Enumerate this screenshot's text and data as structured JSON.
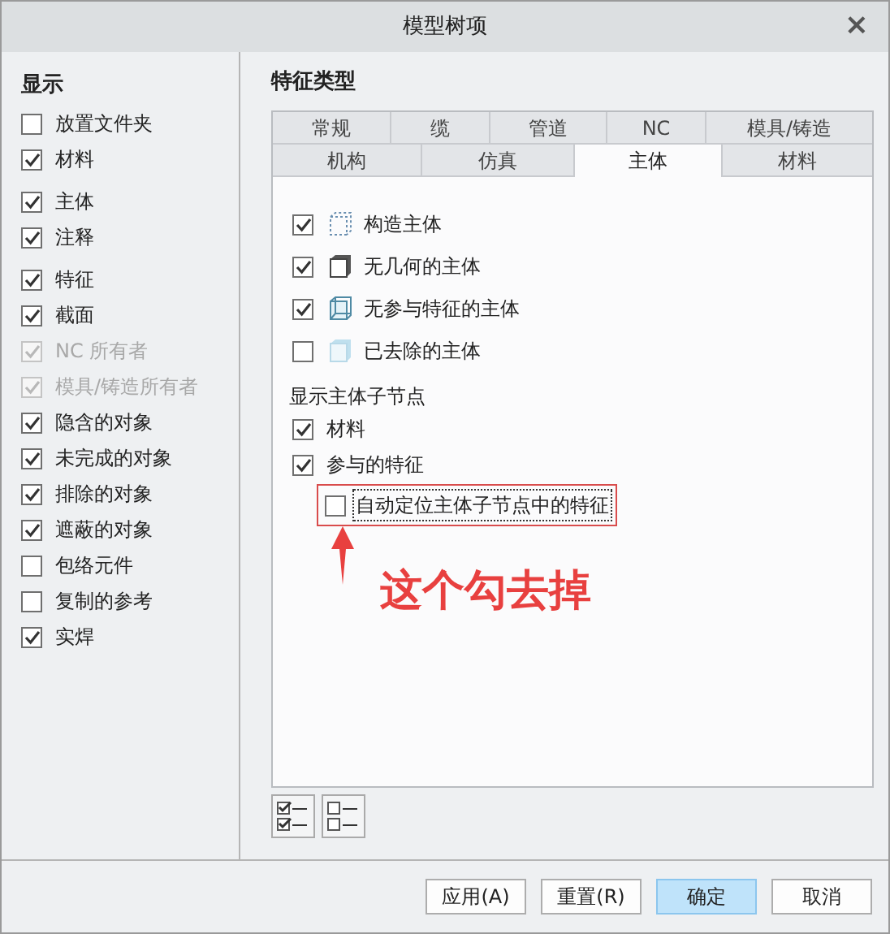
{
  "window": {
    "title": "模型树项",
    "close": "×"
  },
  "display": {
    "heading": "显示",
    "groups": [
      {
        "items": [
          {
            "label": "放置文件夹",
            "checked": false,
            "disabled": false
          },
          {
            "label": "材料",
            "checked": true,
            "disabled": false
          }
        ]
      },
      {
        "items": [
          {
            "label": "主体",
            "checked": true,
            "disabled": false
          },
          {
            "label": "注释",
            "checked": true,
            "disabled": false
          }
        ]
      },
      {
        "items": [
          {
            "label": "特征",
            "checked": true,
            "disabled": false
          },
          {
            "label": "截面",
            "checked": true,
            "disabled": false
          },
          {
            "label": "NC 所有者",
            "checked": true,
            "disabled": true
          },
          {
            "label": "模具/铸造所有者",
            "checked": true,
            "disabled": true
          },
          {
            "label": "隐含的对象",
            "checked": true,
            "disabled": false
          },
          {
            "label": "未完成的对象",
            "checked": true,
            "disabled": false
          },
          {
            "label": "排除的对象",
            "checked": true,
            "disabled": false
          },
          {
            "label": "遮蔽的对象",
            "checked": true,
            "disabled": false
          },
          {
            "label": "包络元件",
            "checked": false,
            "disabled": false
          },
          {
            "label": "复制的参考",
            "checked": false,
            "disabled": false
          },
          {
            "label": "实焊",
            "checked": true,
            "disabled": false
          }
        ]
      }
    ]
  },
  "feature_types": {
    "heading": "特征类型",
    "tab_rows": [
      [
        {
          "label": "常规",
          "selected": false
        },
        {
          "label": "缆",
          "selected": false
        },
        {
          "label": "管道",
          "selected": false
        },
        {
          "label": "NC",
          "selected": false
        },
        {
          "label": "模具/铸造",
          "selected": false
        }
      ],
      [
        {
          "label": "机构",
          "selected": false
        },
        {
          "label": "仿真",
          "selected": false
        },
        {
          "label": "主体",
          "selected": true
        },
        {
          "label": "材料",
          "selected": false
        }
      ]
    ],
    "body_types": [
      {
        "kind": "construction",
        "label": "构造主体",
        "checked": true
      },
      {
        "kind": "solid",
        "label": "无几何的主体",
        "checked": true
      },
      {
        "kind": "inner",
        "label": "无参与特征的主体",
        "checked": true
      },
      {
        "kind": "removed",
        "label": "已去除的主体",
        "checked": false
      }
    ],
    "child_nodes": {
      "heading": "显示主体子节点",
      "items": [
        {
          "label": "材料",
          "checked": true
        },
        {
          "label": "参与的特征",
          "checked": true,
          "children": [
            {
              "label": "自动定位主体子节点中的特征",
              "checked": false,
              "focused": true,
              "highlighted": true
            }
          ]
        }
      ]
    }
  },
  "annotation": {
    "text": "这个勾去掉"
  },
  "buttons": [
    {
      "label": "应用(A)",
      "primary": false
    },
    {
      "label": "重置(R)",
      "primary": false
    },
    {
      "label": "确定",
      "primary": true
    },
    {
      "label": "取消",
      "primary": false
    }
  ]
}
